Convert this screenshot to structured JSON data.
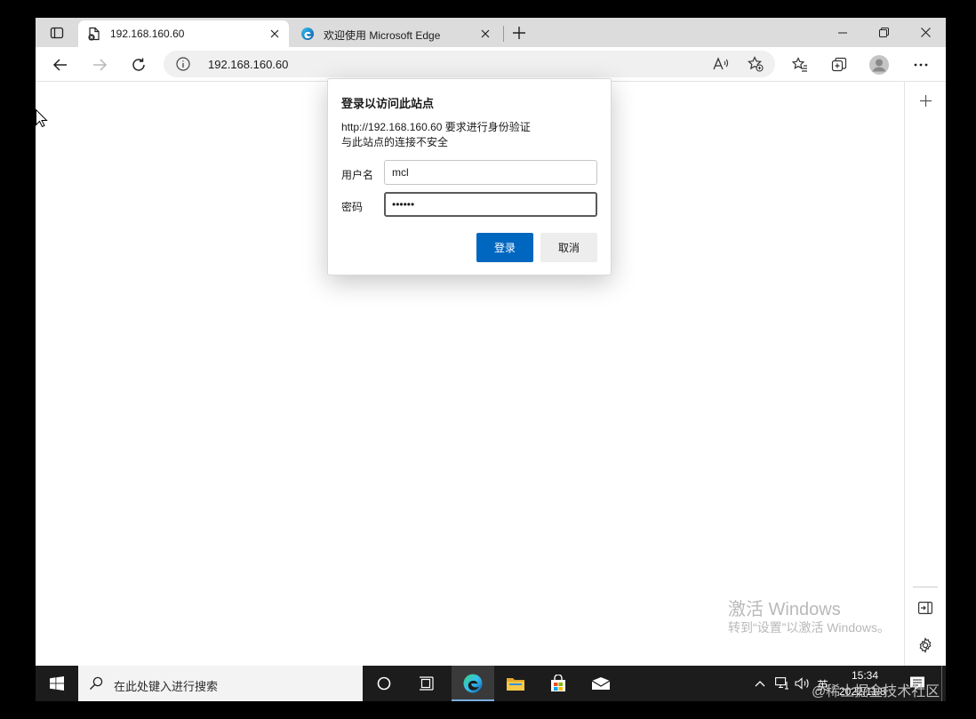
{
  "browser": {
    "tabs": [
      {
        "title": "192.168.160.60",
        "active": true
      },
      {
        "title": "欢迎使用 Microsoft Edge",
        "active": false
      }
    ],
    "address_bar": {
      "url": "192.168.160.60"
    }
  },
  "dialog": {
    "title": "登录以访问此站点",
    "message_line1": "http://192.168.160.60 要求进行身份验证",
    "message_line2": "与此站点的连接不安全",
    "username_label": "用户名",
    "username_value": "mcl",
    "password_label": "密码",
    "password_value": "••••••",
    "login_button": "登录",
    "cancel_button": "取消"
  },
  "watermark": {
    "line1": "激活 Windows",
    "line2": "转到“设置”以激活 Windows。"
  },
  "taskbar": {
    "search_placeholder": "在此处键入进行搜索",
    "ime_indicator": "英",
    "time": "15:34",
    "date": "2022/11/8"
  },
  "external_watermark": "@稀土掘金技术社区",
  "colors": {
    "primary_button": "#0067c0",
    "taskbar_bg": "#1c1c1c",
    "tabbar_bg": "#dcdcdc"
  }
}
